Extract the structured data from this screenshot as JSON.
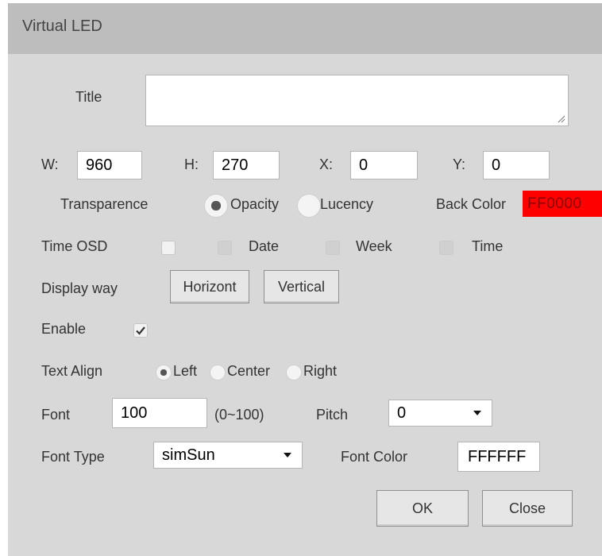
{
  "dialog": {
    "title": "Virtual LED"
  },
  "title_row": {
    "label": "Title",
    "value": ""
  },
  "geometry": {
    "w_label": "W:",
    "w_value": "960",
    "h_label": "H:",
    "h_value": "270",
    "x_label": "X:",
    "x_value": "0",
    "y_label": "Y:",
    "y_value": "0"
  },
  "transparence": {
    "label": "Transparence",
    "options": [
      "Opacity",
      "Lucency"
    ],
    "selected": "Opacity",
    "back_color_label": "Back Color",
    "back_color_value": "FF0000"
  },
  "time_osd": {
    "label": "Time OSD",
    "checked": false,
    "date_label": "Date",
    "week_label": "Week",
    "time_label": "Time"
  },
  "display_way": {
    "label": "Display way",
    "horizontal_label": "Horizont",
    "vertical_label": "Vertical"
  },
  "enable": {
    "label": "Enable",
    "checked": true
  },
  "text_align": {
    "label": "Text Align",
    "options": [
      "Left",
      "Center",
      "Right"
    ],
    "selected": "Left"
  },
  "font": {
    "label": "Font",
    "value": "100",
    "range": "(0~100)",
    "pitch_label": "Pitch",
    "pitch_value": "0"
  },
  "font_type": {
    "label": "Font Type",
    "value": "simSun",
    "color_label": "Font Color",
    "color_value": "FFFFFF"
  },
  "actions": {
    "ok_label": "OK",
    "close_label": "Close"
  },
  "colors": {
    "dialog_bg": "#d8d8d8",
    "titlebar_bg": "#bdbdbd",
    "back_color_swatch": "#ff0000"
  }
}
